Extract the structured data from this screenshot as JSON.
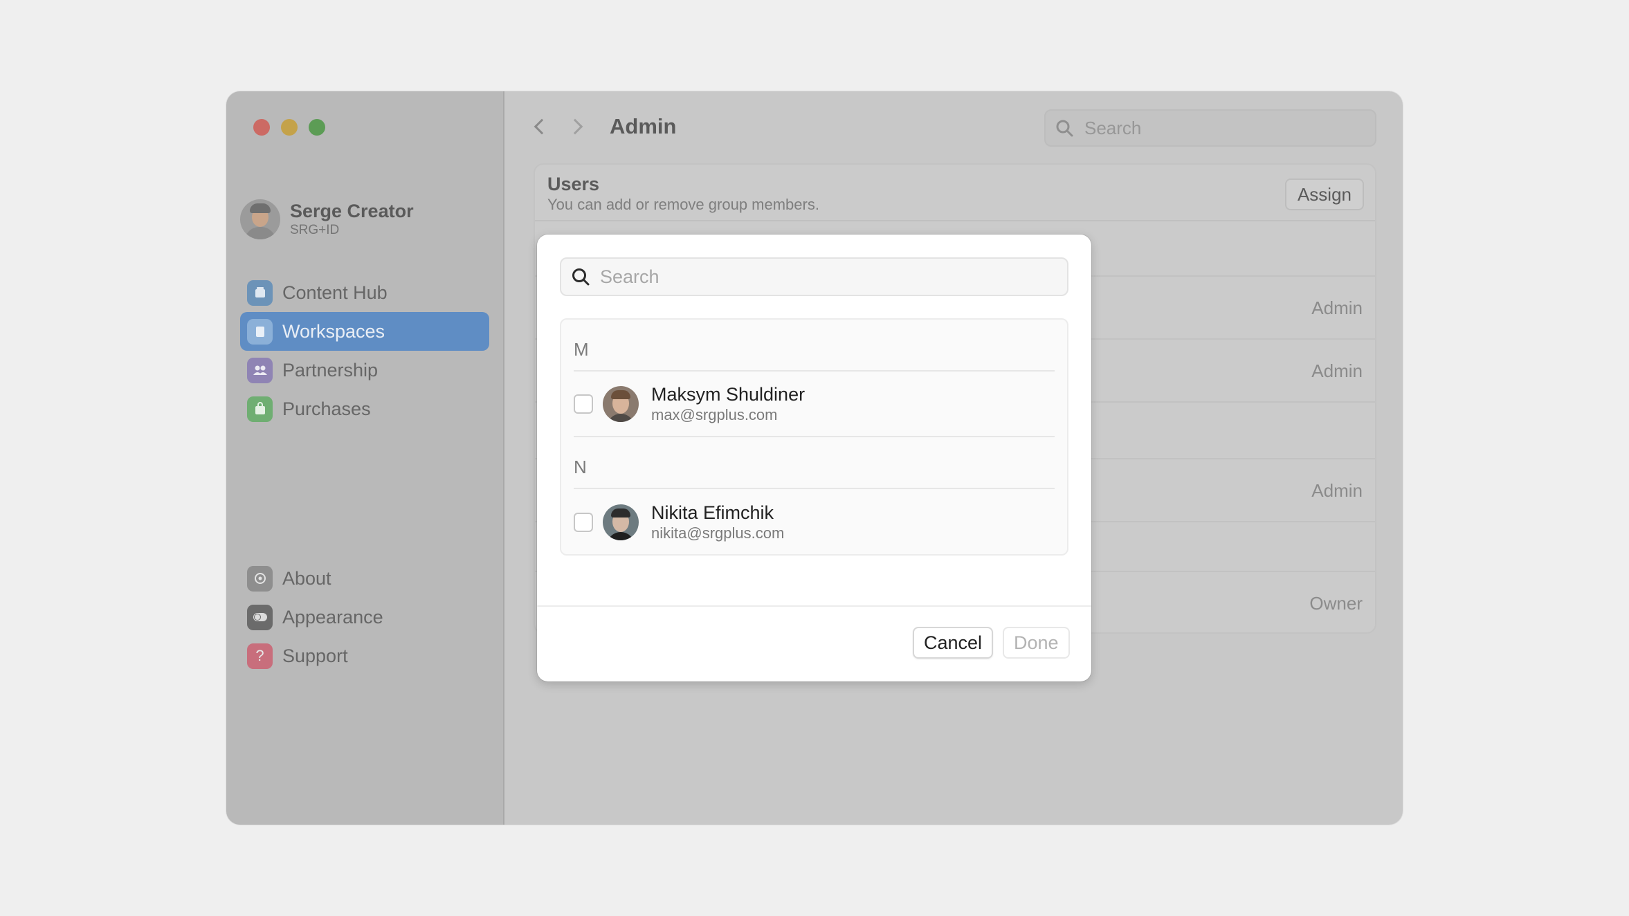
{
  "window": {
    "title": "Admin",
    "search_placeholder": "Search"
  },
  "profile": {
    "name": "Serge Creator",
    "id": "SRG+ID"
  },
  "sidebar": {
    "items": [
      {
        "label": "Content Hub",
        "icon": "content-hub-icon",
        "color": "#6c93b8"
      },
      {
        "label": "Workspaces",
        "icon": "workspaces-icon",
        "color": "#8bb0d8",
        "active": true
      },
      {
        "label": "Partnership",
        "icon": "partnership-icon",
        "color": "#8f84b4"
      },
      {
        "label": "Purchases",
        "icon": "purchases-icon",
        "color": "#6fae72"
      }
    ],
    "secondary": [
      {
        "label": "About",
        "icon": "gear-icon",
        "color": "#8e8e8e"
      },
      {
        "label": "Appearance",
        "icon": "appearance-icon",
        "color": "#6b6b6b"
      },
      {
        "label": "Support",
        "icon": "question-icon",
        "color": "#c86e7c"
      }
    ]
  },
  "panel": {
    "title": "Users",
    "subtitle": "You can add or remove group members.",
    "assign_label": "Assign",
    "rows": [
      {
        "role": ""
      },
      {
        "role": "Admin"
      },
      {
        "role": "Admin"
      },
      {
        "role": ""
      },
      {
        "role": "Admin"
      },
      {
        "role": ""
      },
      {
        "role": "Owner"
      }
    ]
  },
  "modal": {
    "search_placeholder": "Search",
    "groups": [
      {
        "letter": "M",
        "people": [
          {
            "name": "Maksym Shuldiner",
            "email": "max@srgplus.com",
            "checked": false
          }
        ]
      },
      {
        "letter": "N",
        "people": [
          {
            "name": "Nikita Efimchik",
            "email": "nikita@srgplus.com",
            "checked": false
          }
        ]
      }
    ],
    "cancel_label": "Cancel",
    "done_label": "Done"
  }
}
